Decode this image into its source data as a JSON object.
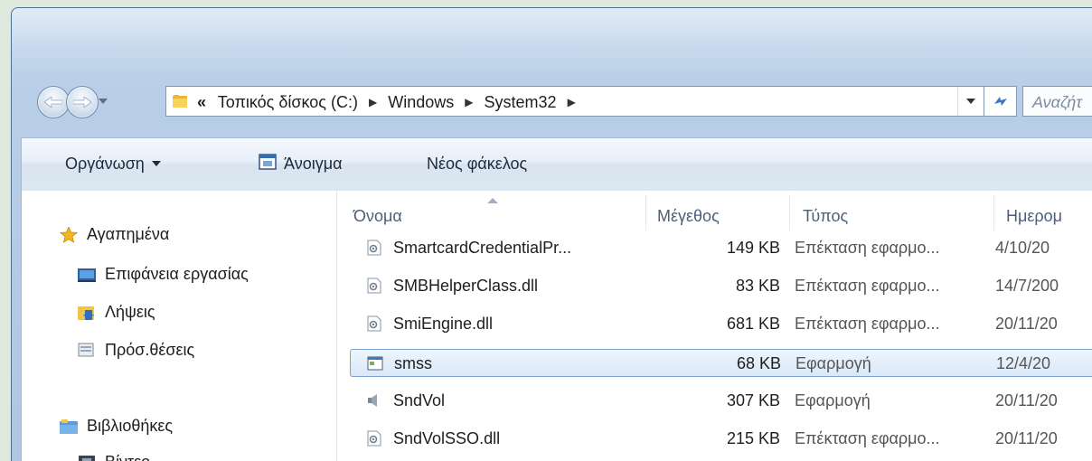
{
  "address": {
    "overflow": "«",
    "crumbs": [
      "Τοπικός δίσκος (C:)",
      "Windows",
      "System32"
    ],
    "search_placeholder": "Αναζήτ"
  },
  "toolbar": {
    "organize": "Οργάνωση",
    "open": "Άνοιγμα",
    "new_folder": "Νέος φάκελος"
  },
  "nav_pane": {
    "favorites": "Αγαπημένα",
    "desktop": "Επιφάνεια εργασίας",
    "downloads": "Λήψεις",
    "recent_places": "Πρόσ.θέσεις",
    "libraries": "Βιβλιοθήκες",
    "videos": "Βίντεο"
  },
  "columns": {
    "name": "Όνομα",
    "size": "Μέγεθος",
    "type": "Τύπος",
    "date": "Ημερομ"
  },
  "files": [
    {
      "name": "SmartcardCredentialPr...",
      "size": "149 KB",
      "type": "Επέκταση εφαρμο...",
      "date": "4/10/20",
      "icon": "dll-file-icon"
    },
    {
      "name": "SMBHelperClass.dll",
      "size": "83 KB",
      "type": "Επέκταση εφαρμο...",
      "date": "14/7/200",
      "icon": "dll-file-icon"
    },
    {
      "name": "SmiEngine.dll",
      "size": "681 KB",
      "type": "Επέκταση εφαρμο...",
      "date": "20/11/20",
      "icon": "dll-file-icon"
    },
    {
      "name": "smss",
      "size": "68 KB",
      "type": "Εφαρμογή",
      "date": "12/4/20",
      "icon": "application-window-icon",
      "selected": true
    },
    {
      "name": "SndVol",
      "size": "307 KB",
      "type": "Εφαρμογή",
      "date": "20/11/20",
      "icon": "speaker-icon"
    },
    {
      "name": "SndVolSSO.dll",
      "size": "215 KB",
      "type": "Επέκταση εφαρμο...",
      "date": "20/11/20",
      "icon": "dll-file-icon"
    }
  ],
  "colors": {
    "selection_border": "#7da2ce",
    "selection_fill": "#d9e8f8",
    "header_text": "#4c607a",
    "frame": "#b9cfe7"
  }
}
